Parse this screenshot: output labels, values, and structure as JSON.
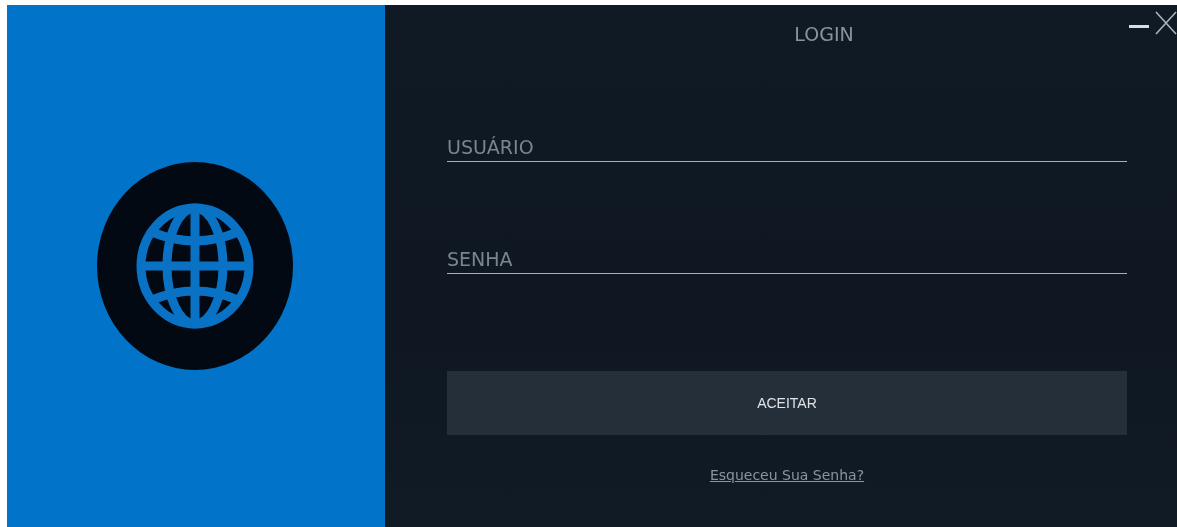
{
  "window": {
    "title": "LOGIN"
  },
  "fields": [
    {
      "placeholder": "USUÁRIO"
    },
    {
      "placeholder": "SENHA"
    }
  ],
  "button": "ACEITAR",
  "link": "Esqueceu Sua Senha?"
}
